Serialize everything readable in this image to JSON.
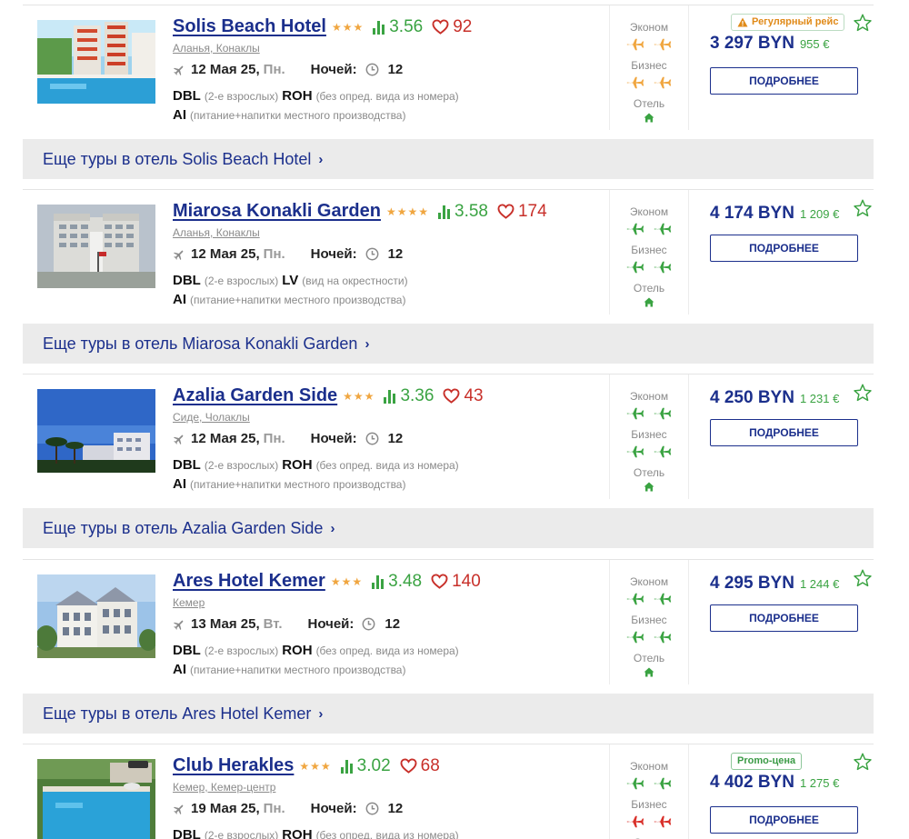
{
  "colors": {
    "accent": "#1b2f8c",
    "rating": "#3aa342",
    "likes": "#c8302a",
    "star": "#f0a640",
    "flight_regular": "#f0a640",
    "flight_ok": "#3aa342",
    "flight_none": "#d9302a"
  },
  "labels": {
    "nights": "Ночей:",
    "economy": "Эконом",
    "business": "Бизнес",
    "hotel": "Отель",
    "details": "ПОДРОБНЕЕ"
  },
  "hotels": [
    {
      "name": "Solis Beach Hotel",
      "stars": "★★★",
      "rating": "3.56",
      "likes": "92",
      "location": "Аланья, Конаклы",
      "date": "12 Мая 25",
      "weekday": "Пн.",
      "nights": "12",
      "room": "DBL",
      "guests": "(2-е взрослых)",
      "room_type": "ROH",
      "room_view": "(без опред. вида из номера)",
      "meal": "AI",
      "meal_desc": "(питание+напитки местного производства)",
      "economy_icon": "plane-orange-icon",
      "business_icon": "plane-orange-icon",
      "badge": "Регулярный рейс",
      "price_byn": "3 297 BYN",
      "price_eur": "955 €",
      "more": "Еще туры в отель Solis Beach Hotel"
    },
    {
      "name": "Miarosa Konakli Garden",
      "stars": "★★★★",
      "rating": "3.58",
      "likes": "174",
      "location": "Аланья, Конаклы",
      "date": "12 Мая 25",
      "weekday": "Пн.",
      "nights": "12",
      "room": "DBL",
      "guests": "(2-е взрослых)",
      "room_type": "LV",
      "room_view": "(вид на окрестности)",
      "meal": "AI",
      "meal_desc": "(питание+напитки местного производства)",
      "economy_icon": "plane-green-icon",
      "business_icon": "plane-green-icon",
      "badge": "",
      "price_byn": "4 174 BYN",
      "price_eur": "1 209 €",
      "more": "Еще туры в отель Miarosa Konakli Garden"
    },
    {
      "name": "Azalia Garden Side",
      "stars": "★★★",
      "rating": "3.36",
      "likes": "43",
      "location": "Сиде, Чолаклы",
      "date": "12 Мая 25",
      "weekday": "Пн.",
      "nights": "12",
      "room": "DBL",
      "guests": "(2-е взрослых)",
      "room_type": "ROH",
      "room_view": "(без опред. вида из номера)",
      "meal": "AI",
      "meal_desc": "(питание+напитки местного производства)",
      "economy_icon": "plane-green-icon",
      "business_icon": "plane-green-icon",
      "badge": "",
      "price_byn": "4 250 BYN",
      "price_eur": "1 231 €",
      "more": "Еще туры в отель Azalia Garden Side"
    },
    {
      "name": "Ares Hotel Kemer",
      "stars": "★★★",
      "rating": "3.48",
      "likes": "140",
      "location": "Кемер",
      "date": "13 Мая 25",
      "weekday": "Вт.",
      "nights": "12",
      "room": "DBL",
      "guests": "(2-е взрослых)",
      "room_type": "ROH",
      "room_view": "(без опред. вида из номера)",
      "meal": "AI",
      "meal_desc": "(питание+напитки местного производства)",
      "economy_icon": "plane-green-icon",
      "business_icon": "plane-green-icon",
      "badge": "",
      "price_byn": "4 295 BYN",
      "price_eur": "1 244 €",
      "more": "Еще туры в отель Ares Hotel Kemer"
    },
    {
      "name": "Club Herakles",
      "stars": "★★★",
      "rating": "3.02",
      "likes": "68",
      "location": "Кемер, Кемер-центр",
      "date": "19 Мая 25",
      "weekday": "Пн.",
      "nights": "12",
      "room": "DBL",
      "guests": "(2-е взрослых)",
      "room_type": "ROH",
      "room_view": "(без опред. вида из номера)",
      "meal": "",
      "meal_desc": "",
      "economy_icon": "plane-green-icon",
      "business_icon": "plane-red-icon",
      "badge": "Promo-цена",
      "price_byn": "4 402 BYN",
      "price_eur": "1 275 €",
      "more": ""
    }
  ]
}
